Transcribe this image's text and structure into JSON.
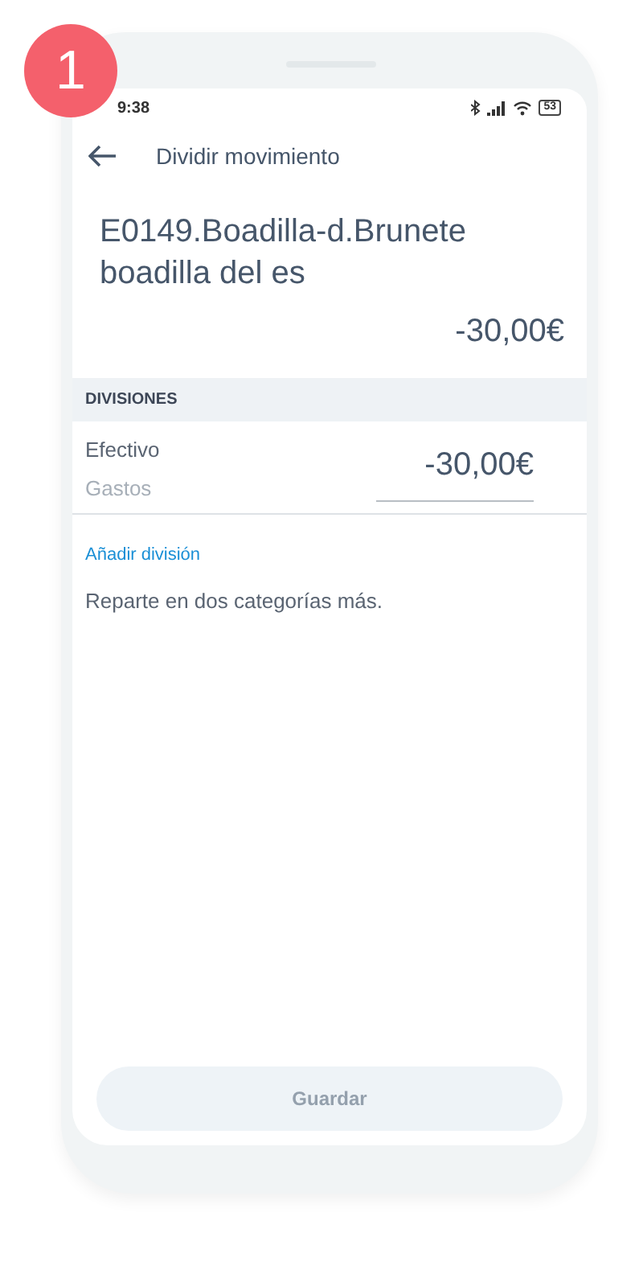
{
  "step_badge": "1",
  "status_bar": {
    "time": "9:38",
    "battery": "53"
  },
  "header": {
    "title": "Dividir movimiento"
  },
  "movement": {
    "title": "E0149.Boadilla-d.Brunete boadilla del es",
    "amount": "-30,00€"
  },
  "divisions": {
    "heading": "DIVISIONES",
    "items": [
      {
        "account": "Efectivo",
        "category": "Gastos",
        "amount": "-30,00€"
      }
    ]
  },
  "add_division": {
    "link": "Añadir división",
    "description": "Reparte en dos categorías más."
  },
  "save_button": {
    "label": "Guardar",
    "disabled": true
  }
}
